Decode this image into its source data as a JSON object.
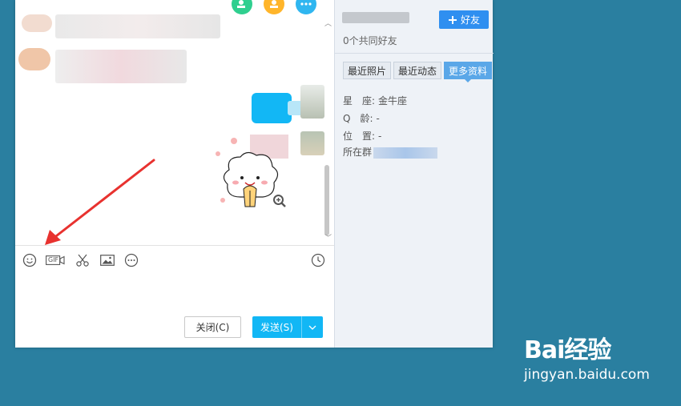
{
  "chat": {
    "toolbar": [
      {
        "icon": "smile-icon"
      },
      {
        "icon": "gif-icon",
        "label": "GIF"
      },
      {
        "icon": "scissors-icon"
      },
      {
        "icon": "image-icon"
      },
      {
        "icon": "more-icon"
      }
    ],
    "history_icon": "clock-icon",
    "buttons": {
      "close": "关闭(C)",
      "send": "发送(S)"
    }
  },
  "profile": {
    "add_friend": "好友",
    "mutual_friends": "0个共同好友",
    "tabs": [
      {
        "label": "最近照片",
        "active": false
      },
      {
        "label": "最近动态",
        "active": false
      },
      {
        "label": "更多资料",
        "active": true
      }
    ],
    "info": [
      {
        "label": "星　座:",
        "value": "金牛座"
      },
      {
        "label": "Q　龄:",
        "value": "-"
      },
      {
        "label": "位　置:",
        "value": "-"
      },
      {
        "label": "所在群",
        "value": ""
      }
    ]
  },
  "watermark": {
    "brand": "Bai经验",
    "url": "jingyan.baidu.com"
  },
  "colors": {
    "accent": "#12b7f5",
    "add_friend": "#2f8ff0",
    "background": "#2a7fa0",
    "arrow": "#e8322f"
  }
}
